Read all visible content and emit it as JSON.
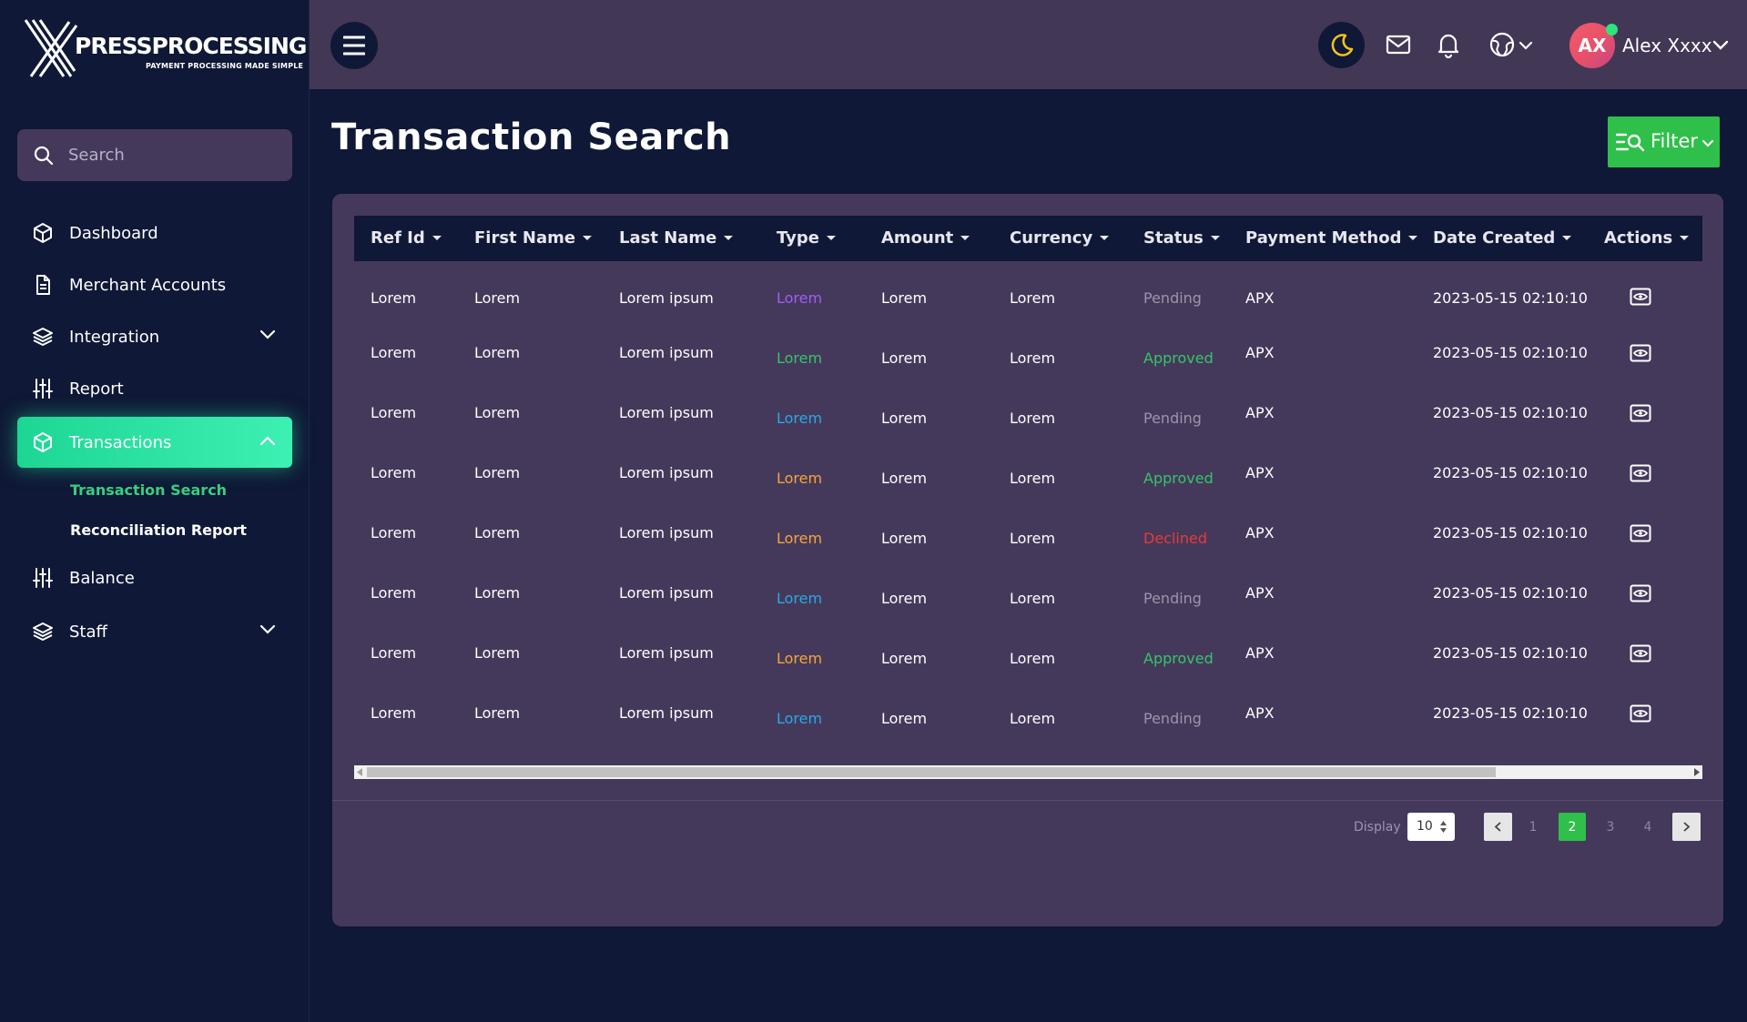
{
  "brand": {
    "name": "PRESSPROCESSING",
    "tagline": "PAYMENT PROCESSING MADE SIMPLE"
  },
  "search": {
    "placeholder": "Search",
    "value": ""
  },
  "sidebar": {
    "items": [
      {
        "label": "Dashboard",
        "icon": "cube-icon"
      },
      {
        "label": "Merchant Accounts",
        "icon": "document-icon"
      },
      {
        "label": "Integration",
        "icon": "layers-icon",
        "expandable": true
      },
      {
        "label": "Report",
        "icon": "sliders-icon"
      },
      {
        "label": "Transactions",
        "icon": "cube-icon",
        "active": true,
        "expanded": true
      },
      {
        "label": "Balance",
        "icon": "sliders-icon"
      },
      {
        "label": "Staff",
        "icon": "layers-icon",
        "expandable": true
      }
    ],
    "subitems": [
      {
        "label": "Transaction Search",
        "current": true
      },
      {
        "label": "Reconciliation Report",
        "current": false
      }
    ]
  },
  "topbar": {
    "avatar_initials": "AX",
    "user_name": "Alex Xxxx",
    "icons": [
      "menu-icon",
      "moon-icon",
      "mail-icon",
      "bell-icon",
      "globe-icon"
    ]
  },
  "page": {
    "title": "Transaction Search",
    "filter_label": "Filter"
  },
  "table": {
    "columns": [
      "Ref Id",
      "First Name",
      "Last Name",
      "Type",
      "Amount",
      "Currency",
      "Status",
      "Payment Method",
      "Date Created",
      "Actions"
    ],
    "rows": [
      {
        "ref_id": "Lorem",
        "first_name": "Lorem",
        "last_name": "Lorem ipsum",
        "type": "Lorem",
        "type_color": "#a05cf5",
        "amount": "Lorem",
        "currency": "Lorem",
        "status": "Pending",
        "payment_method": "APX",
        "date_created": "2023-05-15 02:10:10"
      },
      {
        "ref_id": "Lorem",
        "first_name": "Lorem",
        "last_name": "Lorem ipsum",
        "type": "Lorem",
        "type_color": "#35c46a",
        "amount": "Lorem",
        "currency": "Lorem",
        "status": "Approved",
        "payment_method": "APX",
        "date_created": "2023-05-15 02:10:10"
      },
      {
        "ref_id": "Lorem",
        "first_name": "Lorem",
        "last_name": "Lorem ipsum",
        "type": "Lorem",
        "type_color": "#2aa8e8",
        "amount": "Lorem",
        "currency": "Lorem",
        "status": "Pending",
        "payment_method": "APX",
        "date_created": "2023-05-15 02:10:10"
      },
      {
        "ref_id": "Lorem",
        "first_name": "Lorem",
        "last_name": "Lorem ipsum",
        "type": "Lorem",
        "type_color": "#f5a53a",
        "amount": "Lorem",
        "currency": "Lorem",
        "status": "Approved",
        "payment_method": "APX",
        "date_created": "2023-05-15 02:10:10"
      },
      {
        "ref_id": "Lorem",
        "first_name": "Lorem",
        "last_name": "Lorem ipsum",
        "type": "Lorem",
        "type_color": "#f5a53a",
        "amount": "Lorem",
        "currency": "Lorem",
        "status": "Declined",
        "payment_method": "APX",
        "date_created": "2023-05-15 02:10:10"
      },
      {
        "ref_id": "Lorem",
        "first_name": "Lorem",
        "last_name": "Lorem ipsum",
        "type": "Lorem",
        "type_color": "#2aa8e8",
        "amount": "Lorem",
        "currency": "Lorem",
        "status": "Pending",
        "payment_method": "APX",
        "date_created": "2023-05-15 02:10:10"
      },
      {
        "ref_id": "Lorem",
        "first_name": "Lorem",
        "last_name": "Lorem ipsum",
        "type": "Lorem",
        "type_color": "#f5a53a",
        "amount": "Lorem",
        "currency": "Lorem",
        "status": "Approved",
        "payment_method": "APX",
        "date_created": "2023-05-15 02:10:10"
      },
      {
        "ref_id": "Lorem",
        "first_name": "Lorem",
        "last_name": "Lorem ipsum",
        "type": "Lorem",
        "type_color": "#2aa8e8",
        "amount": "Lorem",
        "currency": "Lorem",
        "status": "Pending",
        "payment_method": "APX",
        "date_created": "2023-05-15 02:10:10"
      }
    ],
    "status_colors": {
      "Pending": "#9c94ab",
      "Approved": "#35c46a",
      "Declined": "#e63a3a"
    }
  },
  "pagination": {
    "display_label": "Display",
    "page_size": "10",
    "pages": [
      "1",
      "2",
      "3",
      "4"
    ],
    "current_page": "2"
  },
  "colors": {
    "accent": "#2ec04a",
    "active_nav": "#1dd694",
    "background": "#0f1836",
    "card": "#45395b"
  }
}
